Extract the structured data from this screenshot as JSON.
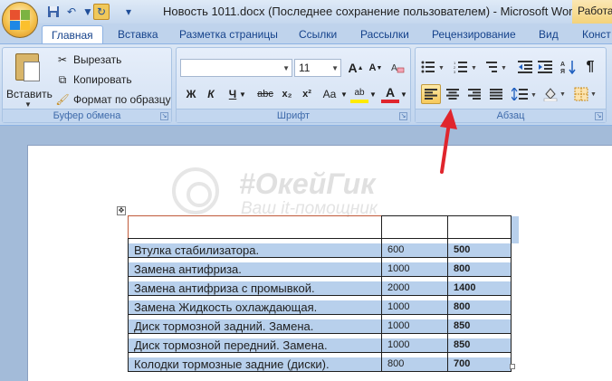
{
  "window": {
    "title": "Новость 1011.docx (Последнее сохранение пользователем) - Microsoft Word",
    "context_tab": "Работа"
  },
  "tabs": [
    {
      "label": "Главная",
      "active": true
    },
    {
      "label": "Вставка"
    },
    {
      "label": "Разметка страницы"
    },
    {
      "label": "Ссылки"
    },
    {
      "label": "Рассылки"
    },
    {
      "label": "Рецензирование"
    },
    {
      "label": "Вид"
    },
    {
      "label": "Конст"
    }
  ],
  "clipboard": {
    "paste_label": "Вставить",
    "cut_label": "Вырезать",
    "copy_label": "Копировать",
    "format_painter_label": "Формат по образцу",
    "group_label": "Буфер обмена"
  },
  "font": {
    "font_name": "",
    "font_size": "11",
    "group_label": "Шрифт",
    "grow_label": "A",
    "shrink_label": "A",
    "bold_label": "Ж",
    "italic_label": "К",
    "underline_label": "Ч",
    "strike_label": "abc",
    "subscript_label": "x₂",
    "superscript_label": "x²",
    "case_label": "Aa",
    "highlight_label": "ab",
    "color_label": "A"
  },
  "paragraph": {
    "group_label": "Абзац",
    "active_alignment": "align-left"
  },
  "watermark": {
    "title": "#ОкейГик",
    "subtitle": "Ваш it-помощник"
  },
  "table": {
    "rows": [
      {
        "name": "",
        "qty": "",
        "price": ""
      },
      {
        "name": "Втулка стабилизатора.",
        "qty": "600",
        "price": "500"
      },
      {
        "name": "Замена антифриза.",
        "qty": "1000",
        "price": "800"
      },
      {
        "name": "Замена антифриза с промывкой.",
        "qty": "2000",
        "price": "1400"
      },
      {
        "name": "Замена Жидкость охлаждающая.",
        "qty": "1000",
        "price": "800"
      },
      {
        "name": "Диск тормозной задний. Замена.",
        "qty": "1000",
        "price": "850"
      },
      {
        "name": "Диск тормозной передний. Замена.",
        "qty": "1000",
        "price": "850"
      },
      {
        "name": "Колодки тормозные задние (диски).",
        "qty": "800",
        "price": "700"
      }
    ]
  },
  "colors": {
    "selection": "#b8d0ec",
    "ribbon": "#d3e1f3",
    "active_button": "#f6c95c",
    "annotation_arrow": "#e0252d"
  }
}
